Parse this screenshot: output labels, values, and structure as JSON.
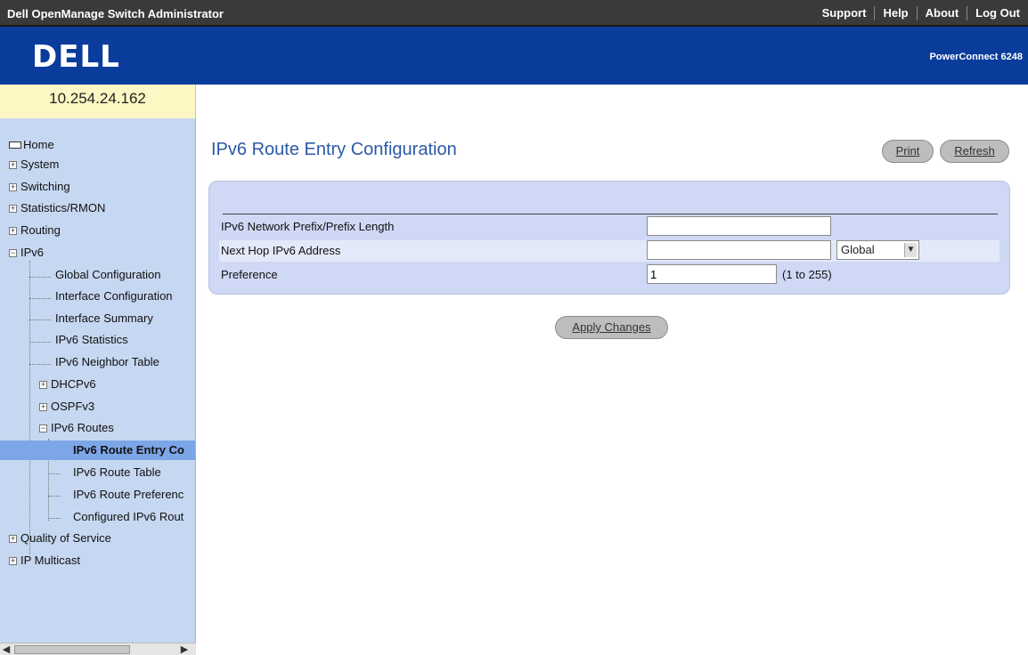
{
  "header": {
    "app_title": "Dell OpenManage Switch Administrator",
    "links": [
      "Support",
      "Help",
      "About",
      "Log Out"
    ],
    "logo_text": "DELL",
    "model": "PowerConnect 6248"
  },
  "sidebar": {
    "ip_address": "10.254.24.162",
    "items": [
      {
        "label": "Home"
      },
      {
        "label": "System"
      },
      {
        "label": "Switching"
      },
      {
        "label": "Statistics/RMON"
      },
      {
        "label": "Routing"
      },
      {
        "label": "IPv6"
      },
      {
        "label": "Global Configuration"
      },
      {
        "label": "Interface Configuration"
      },
      {
        "label": "Interface Summary"
      },
      {
        "label": "IPv6 Statistics"
      },
      {
        "label": "IPv6 Neighbor Table"
      },
      {
        "label": "DHCPv6"
      },
      {
        "label": "OSPFv3"
      },
      {
        "label": "IPv6 Routes"
      },
      {
        "label": "IPv6 Route Entry Co"
      },
      {
        "label": "IPv6 Route Table"
      },
      {
        "label": "IPv6 Route Preferenc"
      },
      {
        "label": "Configured IPv6 Rout"
      },
      {
        "label": "Quality of Service"
      },
      {
        "label": "IP Multicast"
      }
    ]
  },
  "main": {
    "title": "IPv6 Route Entry Configuration",
    "print_label": "Print",
    "refresh_label": "Refresh",
    "form": {
      "prefix_label": "IPv6 Network Prefix/Prefix Length",
      "prefix_value": "",
      "next_hop_label": "Next Hop IPv6 Address",
      "next_hop_value": "",
      "next_hop_type": "Global",
      "preference_label": "Preference",
      "preference_value": "1",
      "preference_range": "(1 to 255)"
    },
    "apply_label": "Apply Changes"
  }
}
